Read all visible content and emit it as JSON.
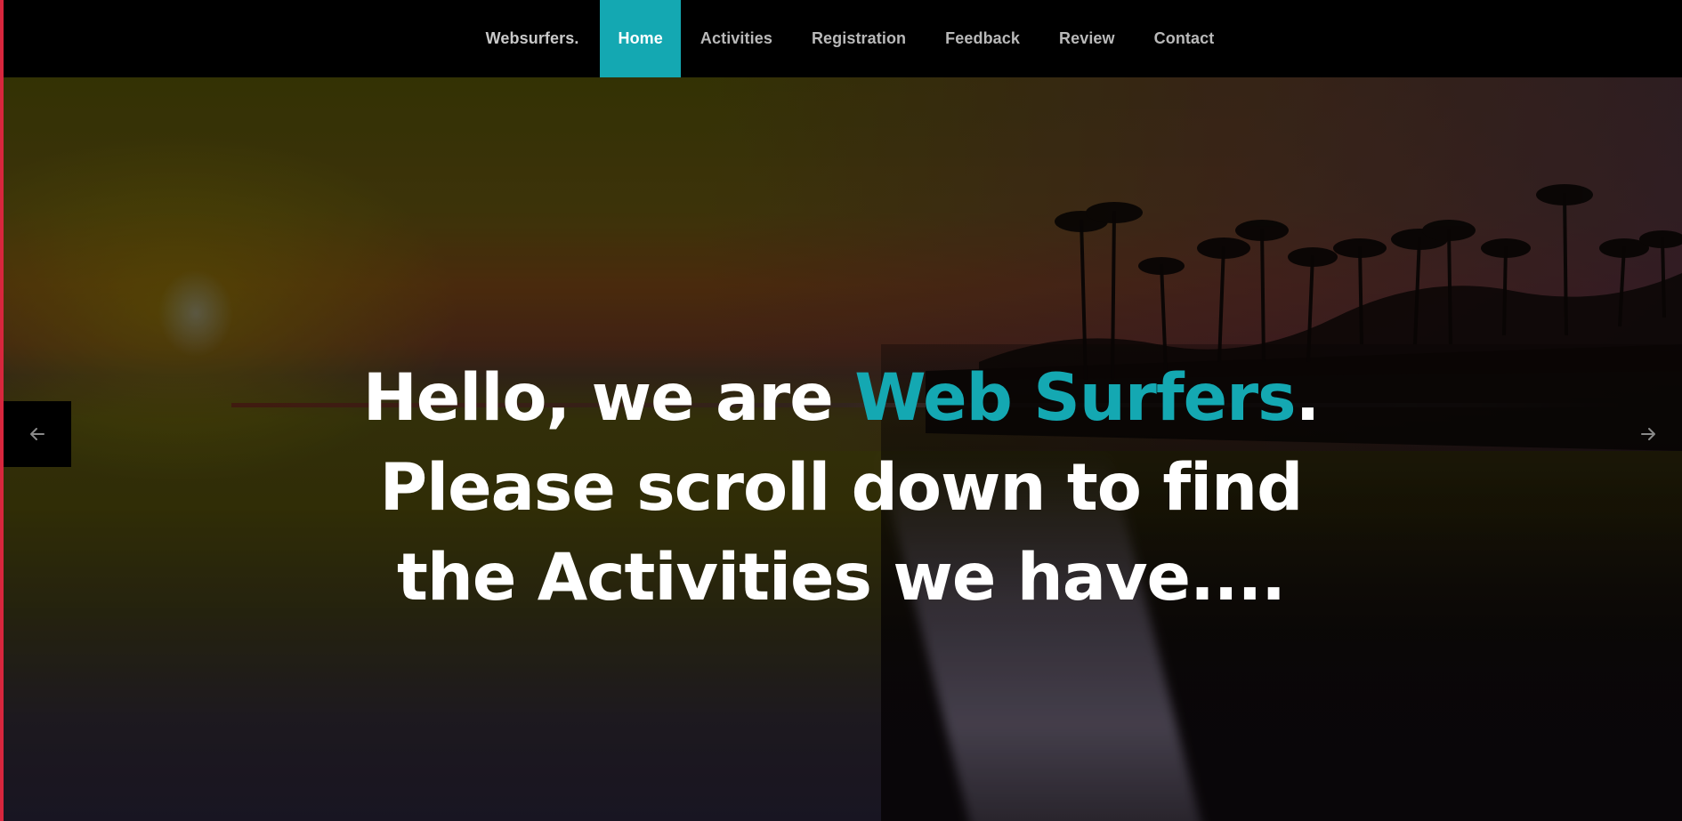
{
  "navbar": {
    "brand": "Websurfers.",
    "items": [
      {
        "label": "Home",
        "active": true
      },
      {
        "label": "Activities",
        "active": false
      },
      {
        "label": "Registration",
        "active": false
      },
      {
        "label": "Feedback",
        "active": false
      },
      {
        "label": "Review",
        "active": false
      },
      {
        "label": "Contact",
        "active": false
      }
    ]
  },
  "hero": {
    "title_prefix": "Hello, we are ",
    "title_accent": "Web Surfers",
    "title_suffix": ".",
    "line2": "Please scroll down to find",
    "line3": "the Activities we have....",
    "prev_icon": "arrow-left-icon",
    "next_icon": "arrow-right-icon"
  },
  "colors": {
    "accent": "#14a8b2",
    "nav_background": "#000000",
    "nav_text": "#b9b9b9",
    "left_edge": "#d7263d"
  }
}
